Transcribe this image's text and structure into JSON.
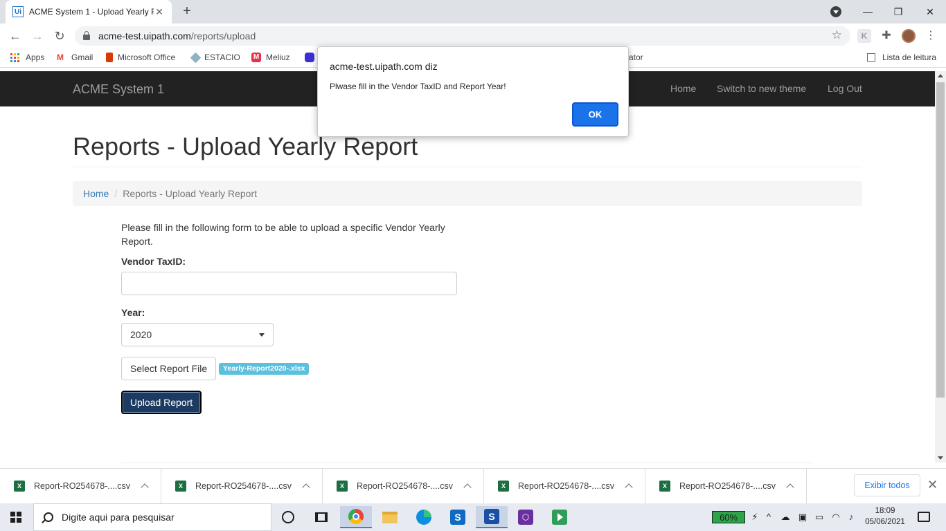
{
  "browser": {
    "tab_title": "ACME System 1 - Upload Yearly R",
    "tab_favicon": "Ui",
    "tab_close": "✕",
    "new_tab": "+",
    "address_host": "acme-test.uipath.com",
    "address_path": "/reports/upload",
    "window_buttons": {
      "minimize": "—",
      "maximize": "❐",
      "close": "✕"
    }
  },
  "bookmarks": [
    {
      "label": "Apps",
      "icon": "apps-grid-icon"
    },
    {
      "label": "Gmail",
      "icon": "gmail-icon"
    },
    {
      "label": "Microsoft Office",
      "icon": "office-icon"
    },
    {
      "label": "ESTACIO",
      "icon": "estacio-icon"
    },
    {
      "label": "Meliuz",
      "icon": "meliuz-icon"
    },
    {
      "label": "ator",
      "icon": ""
    }
  ],
  "reading_list": "Lista de leitura",
  "navbar": {
    "brand": "ACME System 1",
    "links": [
      "Home",
      "Switch to new theme",
      "Log Out"
    ]
  },
  "page": {
    "title": "Reports - Upload Yearly Report",
    "breadcrumb": {
      "home": "Home",
      "separator": "/",
      "current": "Reports - Upload Yearly Report"
    },
    "intro": "Please fill in the following form to be able to upload a specific Vendor Yearly Report.",
    "vendor_label": "Vendor TaxID:",
    "vendor_value": "",
    "year_label": "Year:",
    "year_value": "2020",
    "select_file_label": "Select Report File",
    "file_badge": "Yearly-Report2020-.xlsx",
    "upload_label": "Upload Report"
  },
  "dialog": {
    "title": "acme-test.uipath.com diz",
    "message": "Plwase fill in the Vendor TaxID and Report Year!",
    "ok": "OK"
  },
  "downloads": {
    "items": [
      "Report-RO254678-....csv",
      "Report-RO254678-....csv",
      "Report-RO254678-....csv",
      "Report-RO254678-....csv",
      "Report-RO254678-....csv"
    ],
    "show_all": "Exibir todos",
    "close": "✕"
  },
  "taskbar": {
    "search_placeholder": "Digite aqui para pesquisar",
    "battery": "60%",
    "time": "18:09",
    "date": "05/06/2021"
  }
}
